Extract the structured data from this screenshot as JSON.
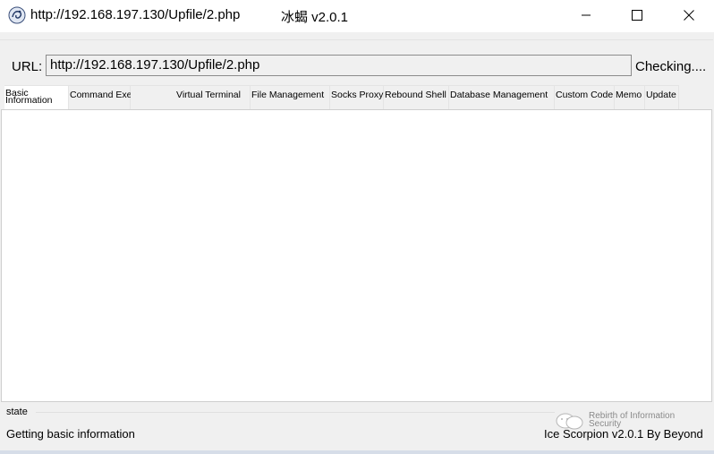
{
  "window": {
    "title": "http://192.168.197.130/Upfile/2.php",
    "app_name_version": "冰蝎 v2.0.1"
  },
  "url_bar": {
    "label": "URL:",
    "value": "http://192.168.197.130/Upfile/2.php",
    "status": "Checking...."
  },
  "tabs": [
    {
      "label": "Basic Information",
      "active": true
    },
    {
      "label": "Command Execution",
      "active": false
    },
    {
      "label": "Virtual Terminal",
      "active": false
    },
    {
      "label": "File Management",
      "active": false
    },
    {
      "label": "Socks Proxy",
      "active": false
    },
    {
      "label": "Rebound Shell",
      "active": false
    },
    {
      "label": "Database Management",
      "active": false
    },
    {
      "label": "Custom Code",
      "active": false
    },
    {
      "label": "Memo",
      "active": false
    },
    {
      "label": "Update",
      "active": false
    }
  ],
  "status_bar": {
    "group_label": "state",
    "message": "Getting basic information",
    "credit": "Ice Scorpion v2.0.1 By Beyond"
  },
  "watermark": {
    "text": "Rebirth of Information Security"
  }
}
